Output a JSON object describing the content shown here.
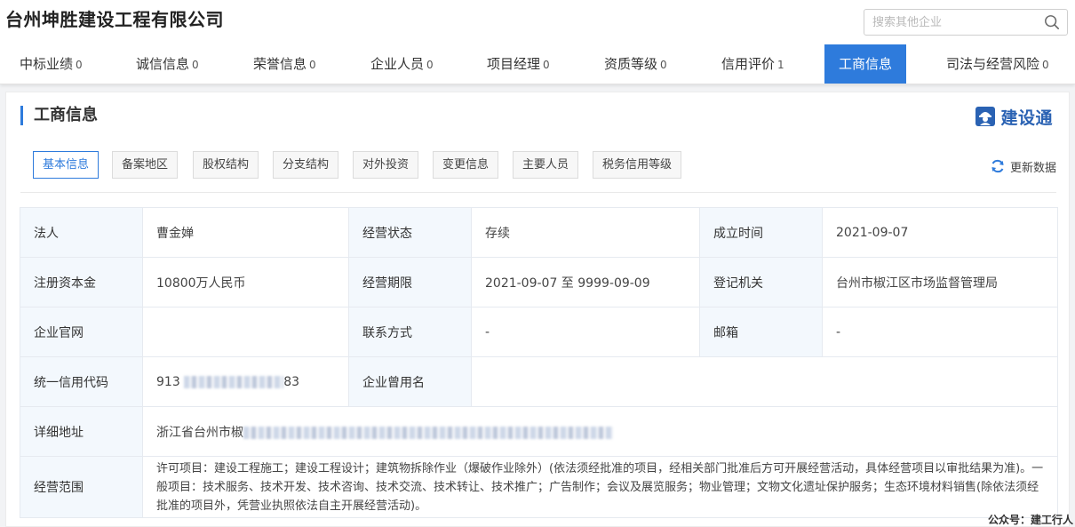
{
  "header": {
    "company_name": "台州坤胜建设工程有限公司",
    "search_placeholder": "搜索其他企业"
  },
  "tabs": [
    {
      "label": "中标业绩",
      "count": "0"
    },
    {
      "label": "诚信信息",
      "count": "0"
    },
    {
      "label": "荣誉信息",
      "count": "0"
    },
    {
      "label": "企业人员",
      "count": "0"
    },
    {
      "label": "项目经理",
      "count": "0"
    },
    {
      "label": "资质等级",
      "count": "0"
    },
    {
      "label": "信用评价",
      "count": "1"
    },
    {
      "label": "工商信息",
      "count": ""
    },
    {
      "label": "司法与经营风险",
      "count": "0"
    }
  ],
  "active_tab": "工商信息",
  "section": {
    "title": "工商信息",
    "brand": "建设通",
    "refresh_label": "更新数据"
  },
  "subtabs": [
    "基本信息",
    "备案地区",
    "股权结构",
    "分支结构",
    "对外投资",
    "变更信息",
    "主要人员",
    "税务信用等级"
  ],
  "active_subtab": "基本信息",
  "info": {
    "legal_rep_label": "法人",
    "legal_rep": "曹金婵",
    "status_label": "经营状态",
    "status": "存续",
    "founded_label": "成立时间",
    "founded": "2021-09-07",
    "capital_label": "注册资本金",
    "capital": "10800万人民币",
    "term_label": "经营期限",
    "term": "2021-09-07 至 9999-09-09",
    "authority_label": "登记机关",
    "authority": "台州市椒江区市场监督管理局",
    "website_label": "企业官网",
    "website": "",
    "contact_label": "联系方式",
    "contact": "-",
    "email_label": "邮箱",
    "email": "-",
    "credit_code_label": "统一信用代码",
    "credit_code_prefix": "913",
    "credit_code_suffix": "83",
    "former_name_label": "企业曾用名",
    "former_name": "",
    "address_label": "详细地址",
    "address_prefix": "浙江省台州市椒",
    "scope_label": "经营范围",
    "scope": "许可项目：建设工程施工；建设工程设计；建筑物拆除作业（爆破作业除外）(依法须经批准的项目，经相关部门批准后方可开展经营活动，具体经营项目以审批结果为准)。一般项目：技术服务、技术开发、技术咨询、技术交流、技术转让、技术推广；广告制作；会议及展览服务；物业管理；文物文化遗址保护服务；生态环境材料销售(除依法须经批准的项目外，凭营业执照依法自主开展经营活动)。"
  },
  "watermark": "公众号：建工行人",
  "colors": {
    "accent": "#2e7bdc",
    "brand": "#2a62b3",
    "label_bg": "#f3f8fd"
  }
}
